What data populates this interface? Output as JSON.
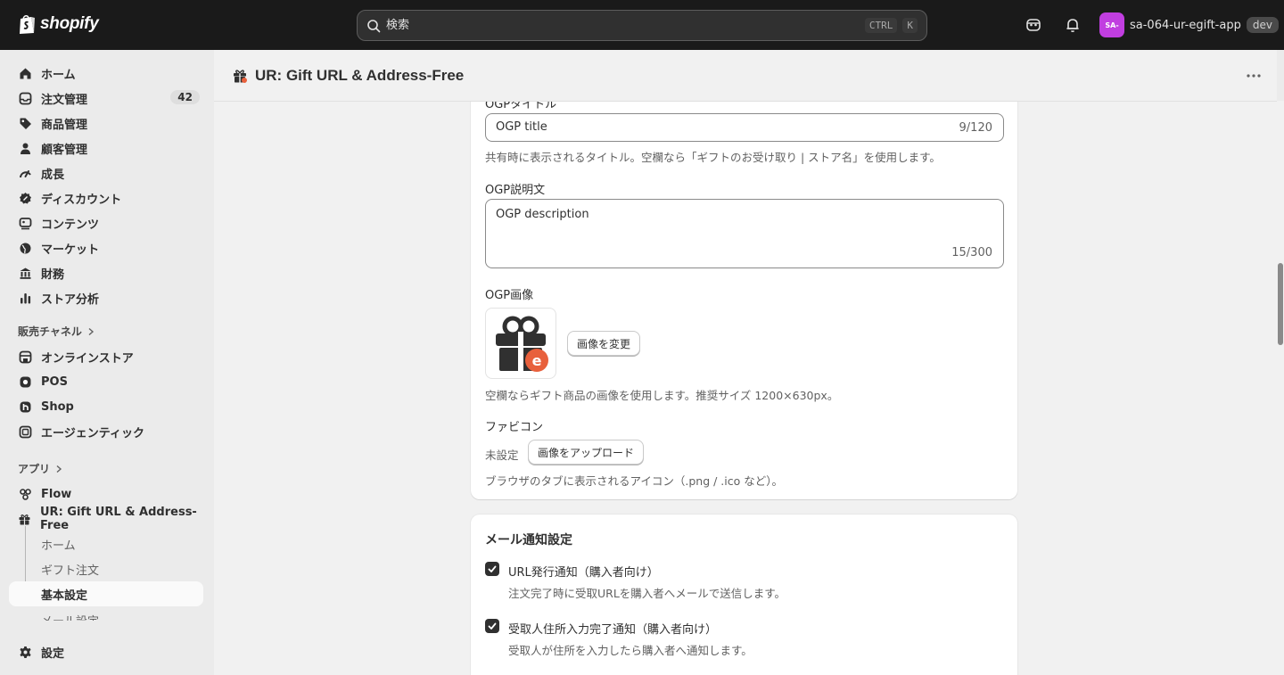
{
  "topbar": {
    "logo_text": "shopify",
    "search_placeholder": "検索",
    "shortcut_ctrl": "CTRL",
    "shortcut_key": "K",
    "avatar_initials": "SA-",
    "store_name": "sa-064-ur-egift-app",
    "env_badge": "dev"
  },
  "sidebar": {
    "items": [
      {
        "label": "ホーム",
        "icon": "home-icon"
      },
      {
        "label": "注文管理",
        "icon": "orders-icon",
        "count": "42"
      },
      {
        "label": "商品管理",
        "icon": "tag-icon"
      },
      {
        "label": "顧客管理",
        "icon": "person-icon"
      },
      {
        "label": "成長",
        "icon": "growth-icon"
      },
      {
        "label": "ディスカウント",
        "icon": "discount-icon"
      },
      {
        "label": "コンテンツ",
        "icon": "content-icon"
      },
      {
        "label": "マーケット",
        "icon": "globe-icon"
      },
      {
        "label": "財務",
        "icon": "bank-icon"
      },
      {
        "label": "ストア分析",
        "icon": "chart-icon"
      }
    ],
    "sales_channels_title": "販売チャネル",
    "channels": [
      {
        "label": "オンラインストア",
        "icon": "store-icon"
      },
      {
        "label": "POS",
        "icon": "pos-icon"
      },
      {
        "label": "Shop",
        "icon": "shop-icon"
      },
      {
        "label": "エージェンティック",
        "icon": "agentic-icon"
      }
    ],
    "apps_title": "アプリ",
    "apps": [
      {
        "label": "Flow",
        "icon": "flow-icon"
      },
      {
        "label": "UR: Gift URL & Address-Free",
        "icon": "gift-app-icon"
      }
    ],
    "app_subitems": [
      "ホーム",
      "ギフト注文",
      "基本設定",
      "メール設定"
    ],
    "settings_label": "設定"
  },
  "page": {
    "title": "UR: Gift URL & Address-Free"
  },
  "ogp": {
    "title_label": "OGPタイトル",
    "title_value": "OGP title",
    "title_count": "9/120",
    "title_help": "共有時に表示されるタイトル。空欄なら「ギフトのお受け取り | ストア名」を使用します。",
    "desc_label": "OGP説明文",
    "desc_value": "OGP description",
    "desc_count": "15/300",
    "image_label": "OGP画像",
    "change_image_button": "画像を変更",
    "image_help": "空欄ならギフト商品の画像を使用します。推奨サイズ 1200×630px。",
    "favicon_label": "ファビコン",
    "favicon_status": "未設定",
    "upload_button": "画像をアップロード",
    "favicon_help": "ブラウザのタブに表示されるアイコン（.png / .ico など）。"
  },
  "mail": {
    "title": "メール通知設定",
    "options": [
      {
        "label": "URL発行通知（購入者向け）",
        "help": "注文完了時に受取URLを購入者へメールで送信します。",
        "checked": true
      },
      {
        "label": "受取人住所入力完了通知（購入者向け）",
        "help": "受取人が住所を入力したら購入者へ通知します。",
        "checked": true
      }
    ]
  },
  "colors": {
    "topbar_bg": "#1a1a1a",
    "avatar_bg": "#c13ee0",
    "accent_orange": "#e8603c"
  }
}
